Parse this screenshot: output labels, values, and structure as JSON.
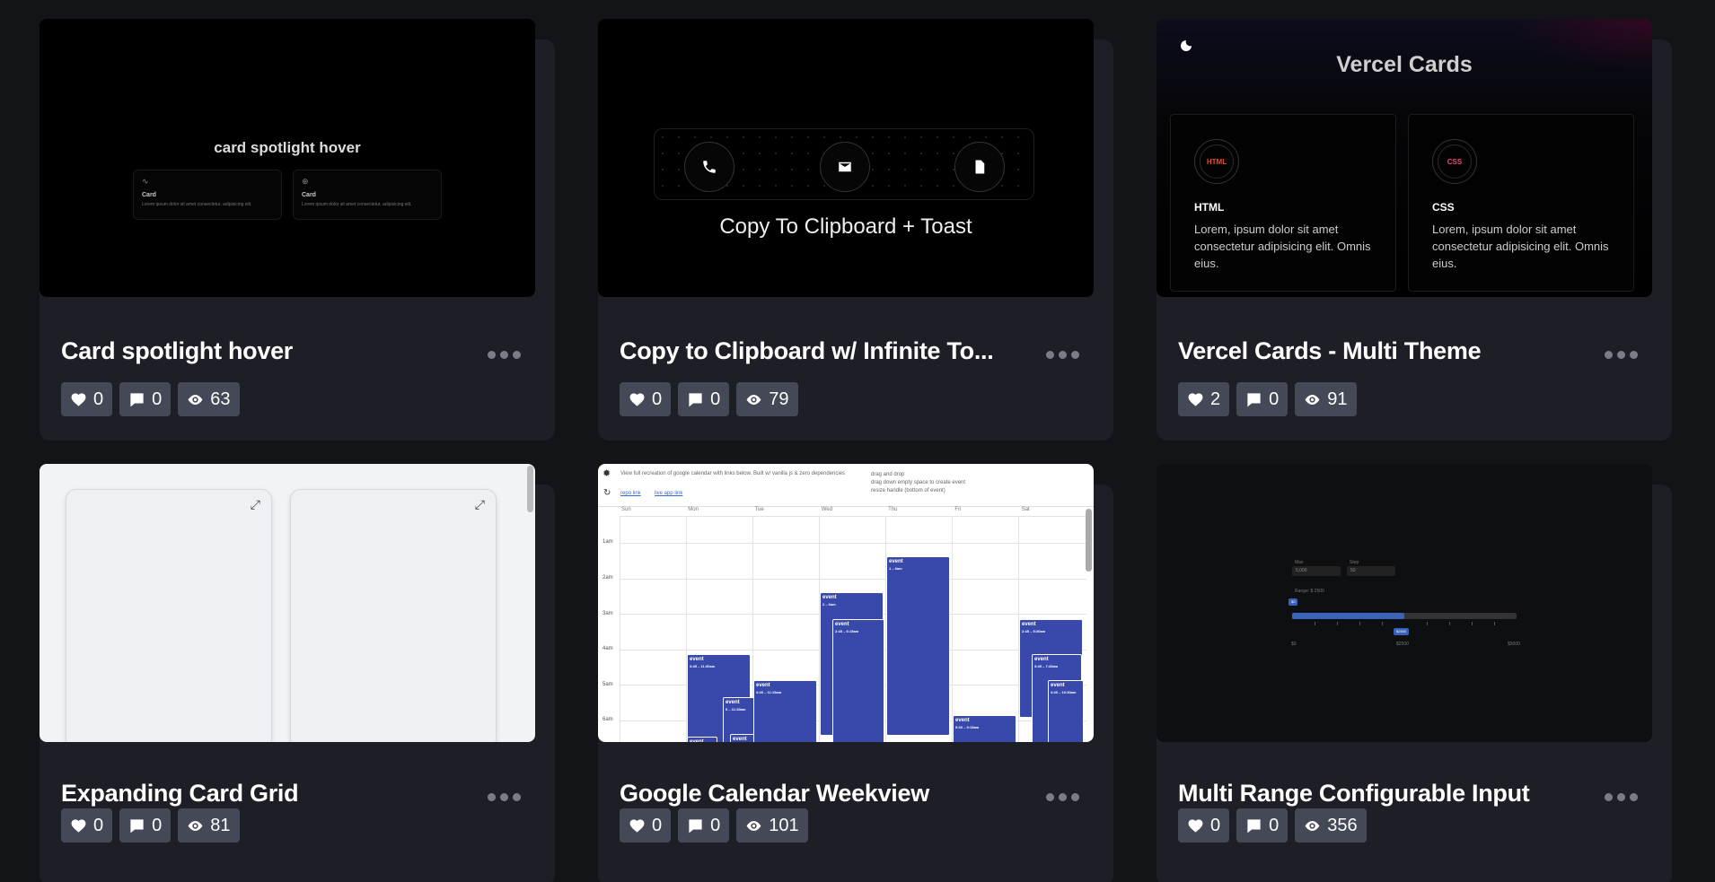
{
  "cards": [
    {
      "title": "Card spotlight hover",
      "likes": "0",
      "comments": "0",
      "views": "63",
      "preview": {
        "heading": "card spotlight hover",
        "mini_cards": [
          {
            "icon": "activity-icon",
            "title": "Card",
            "text": "Lorem ipsum dolor sit amet consectetur, adipisicing elit."
          },
          {
            "icon": "globe-icon",
            "title": "Card",
            "text": "Lorem ipsum dolor sit amet consectetur, adipisicing elit."
          }
        ]
      }
    },
    {
      "title": "Copy to Clipboard w/ Infinite To...",
      "likes": "0",
      "comments": "0",
      "views": "79",
      "preview": {
        "caption": "Copy To Clipboard + Toast",
        "icons": [
          "phone-icon",
          "mail-icon",
          "document-icon"
        ]
      }
    },
    {
      "title": "Vercel Cards - Multi Theme",
      "likes": "2",
      "comments": "0",
      "views": "91",
      "preview": {
        "heading": "Vercel Cards",
        "cards": [
          {
            "badge": "HTML",
            "badge_color": "#e44d26",
            "title": "HTML",
            "text": "Lorem, ipsum dolor sit amet consectetur adipisicing elit. Omnis eius."
          },
          {
            "badge": "CSS",
            "badge_color": "#e44d7a",
            "title": "CSS",
            "text": "Lorem, ipsum dolor sit amet consectetur adipisicing elit. Omnis eius."
          }
        ]
      }
    },
    {
      "title": "Expanding Card Grid",
      "likes": "0",
      "comments": "0",
      "views": "81",
      "preview": {
        "icons": [
          "expand-icon",
          "expand-icon"
        ]
      }
    },
    {
      "title": "Google Calendar Weekview",
      "likes": "0",
      "comments": "0",
      "views": "101",
      "preview": {
        "intro": "View full recreation of google calendar with links below. Built w/ vanilla js & zero dependencies",
        "link1": "repo link",
        "link2": "live app link",
        "help": [
          "drag and drop",
          "drag down empty space to create event",
          "resize handle (bottom of event)"
        ],
        "days": [
          "Sun",
          "Mon",
          "Tue",
          "Wed",
          "Thu",
          "Fri",
          "Sat"
        ],
        "hours": [
          "1am",
          "2am",
          "3am",
          "4am",
          "5am",
          "6am"
        ],
        "event_label": "event",
        "event_color": "#3949ab"
      }
    },
    {
      "title": "Multi Range Configurable Input",
      "likes": "0",
      "comments": "0",
      "views": "356",
      "preview": {
        "max_label": "Max",
        "max_value": "5,000",
        "step_label": "Step",
        "step_value": "50",
        "range_label": "Range: $ 2500",
        "min_tag": "$0",
        "value_tag": "$2500",
        "scale": [
          "$0",
          "$2500",
          "$5000"
        ],
        "accent": "#3a63b8"
      }
    }
  ]
}
